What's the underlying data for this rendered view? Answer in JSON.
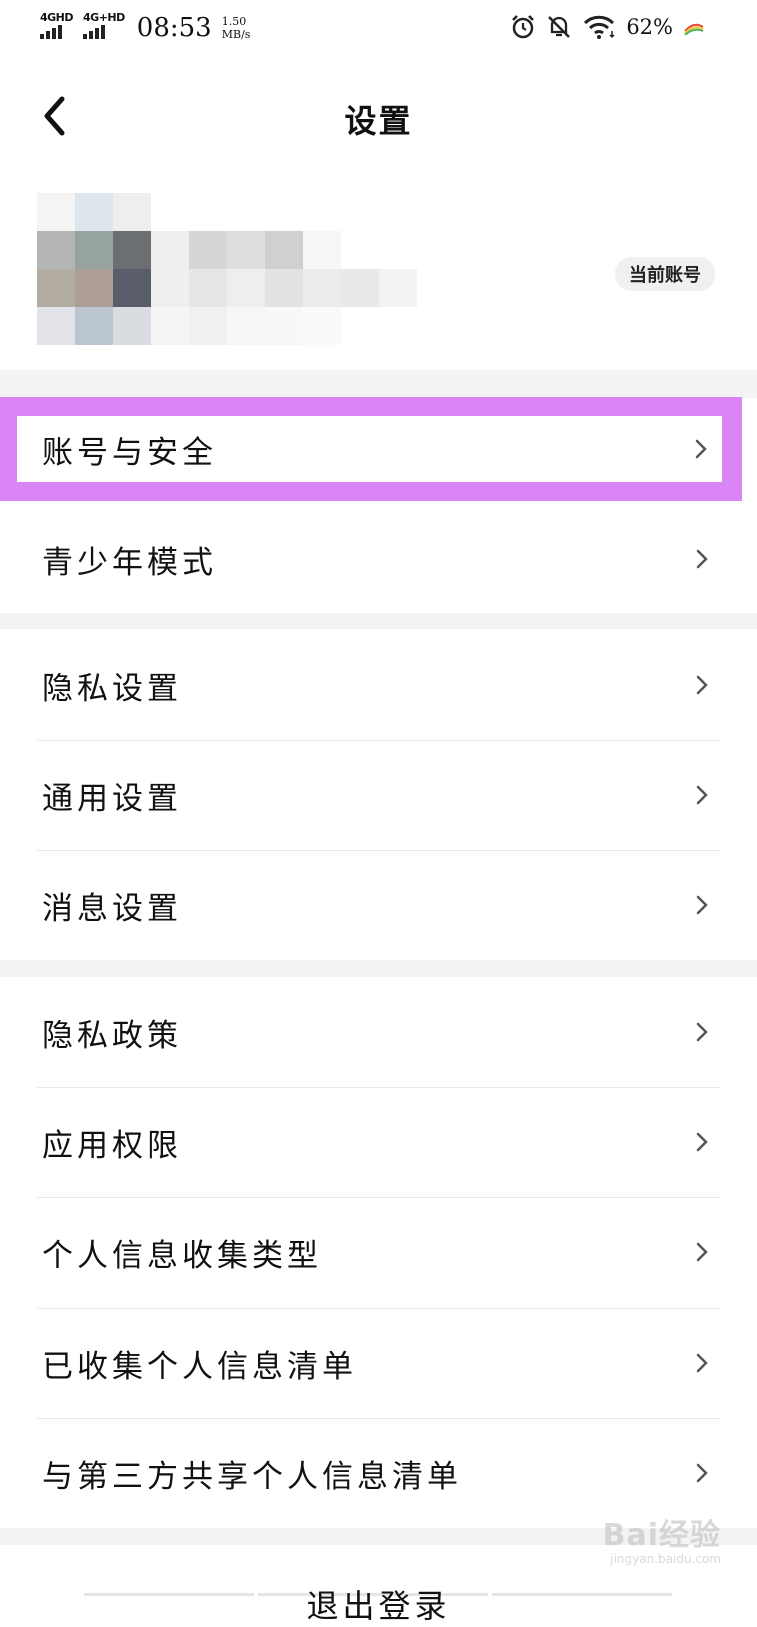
{
  "status_bar": {
    "net1": "4GHD",
    "net2": "4G+HD",
    "time": "08:53",
    "speed_value": "1.50",
    "speed_unit": "MB/s",
    "battery": "62%",
    "icons": [
      "alarm-icon",
      "bell-muted-icon",
      "wifi-icon",
      "rainbow-app-icon"
    ]
  },
  "nav": {
    "title": "设置",
    "back_icon": "chevron-left-icon"
  },
  "account": {
    "badge": "当前账号"
  },
  "menu": {
    "group1": [
      {
        "label": "账号与安全"
      },
      {
        "label": "青少年模式"
      }
    ],
    "group2": [
      {
        "label": "隐私设置"
      },
      {
        "label": "通用设置"
      },
      {
        "label": "消息设置"
      }
    ],
    "group3": [
      {
        "label": "隐私政策"
      },
      {
        "label": "应用权限"
      },
      {
        "label": "个人信息收集类型"
      },
      {
        "label": "已收集个人信息清单"
      },
      {
        "label": "与第三方共享个人信息清单"
      }
    ]
  },
  "logout": {
    "label": "退出登录"
  },
  "watermark": {
    "main": "Bai经验",
    "sub": "jingyan.baidu.com"
  },
  "colors": {
    "highlight": "#d985f5",
    "section_gap": "#f3f3f5",
    "divider": "#e8e8ea"
  }
}
